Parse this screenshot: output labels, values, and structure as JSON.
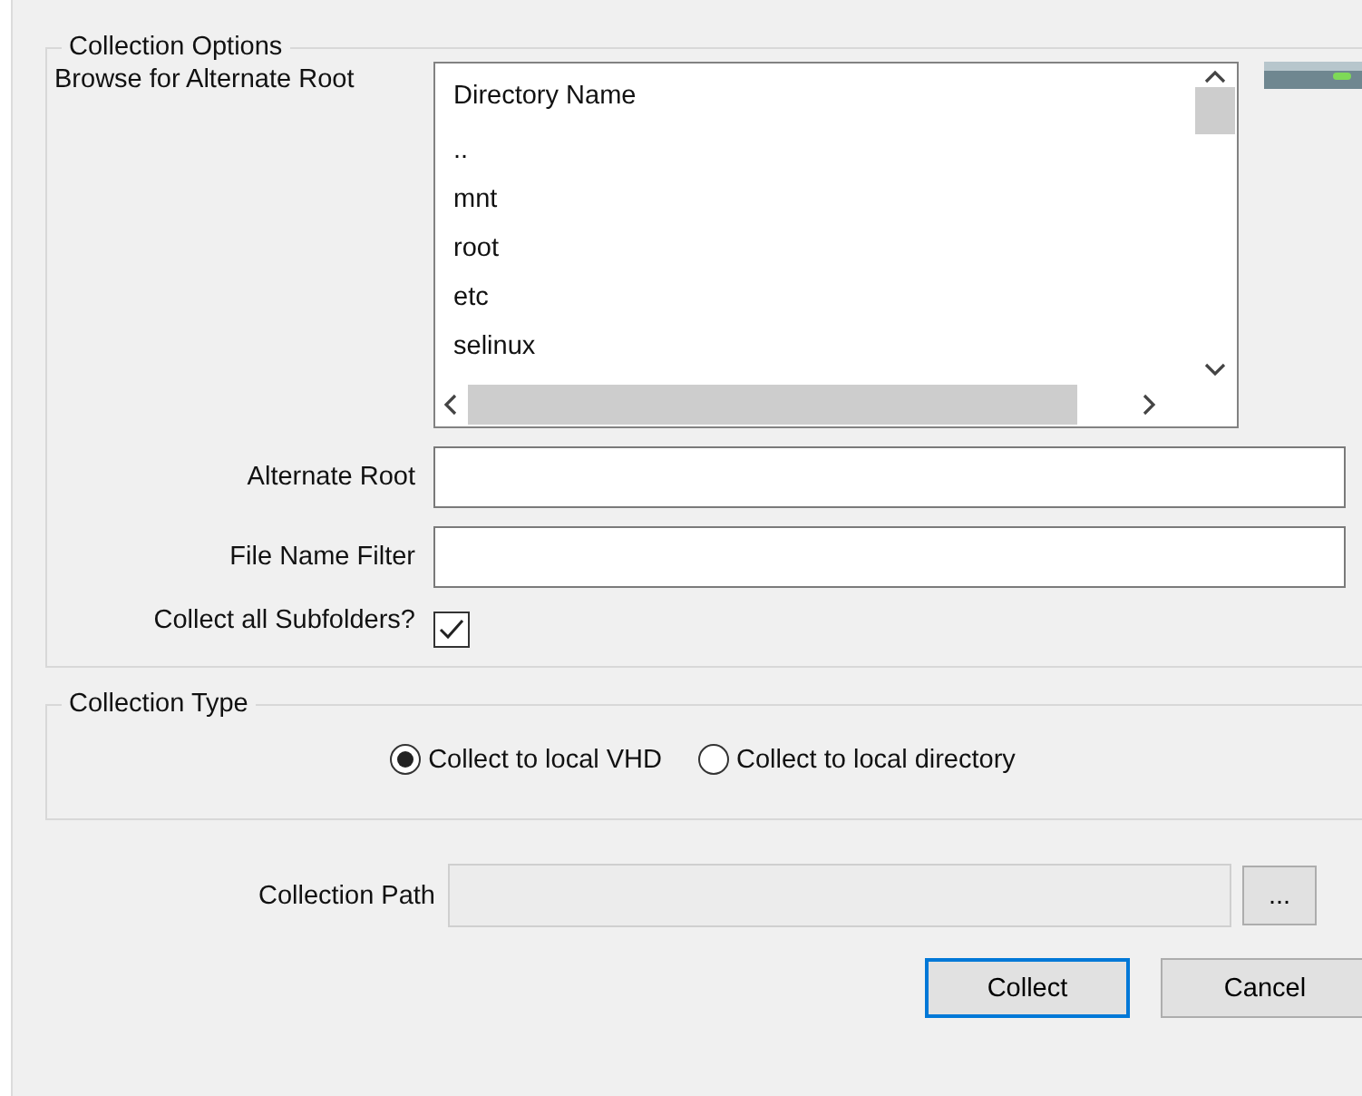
{
  "collection_options": {
    "title": "Collection Options",
    "browse": {
      "label": "Browse for Alternate Root",
      "header": "Directory Name",
      "items": [
        "..",
        "mnt",
        "root",
        "etc",
        "selinux"
      ]
    },
    "fields": [
      {
        "label": "Alternate Root"
      },
      {
        "label": "File Name Filter"
      }
    ],
    "subfolders": {
      "label": "Collect all Subfolders?",
      "checked": true
    }
  },
  "collection_type": {
    "title": "Collection Type",
    "options": [
      {
        "label": "Collect to local VHD",
        "selected": true
      },
      {
        "label": "Collect to local directory",
        "selected": false
      }
    ]
  },
  "collection_path": {
    "label": "Collection Path",
    "disabled": true,
    "browse_button": "..."
  },
  "buttons": [
    {
      "label": "Collect",
      "focused": true
    },
    {
      "label": "Cancel",
      "focused": false
    }
  ]
}
